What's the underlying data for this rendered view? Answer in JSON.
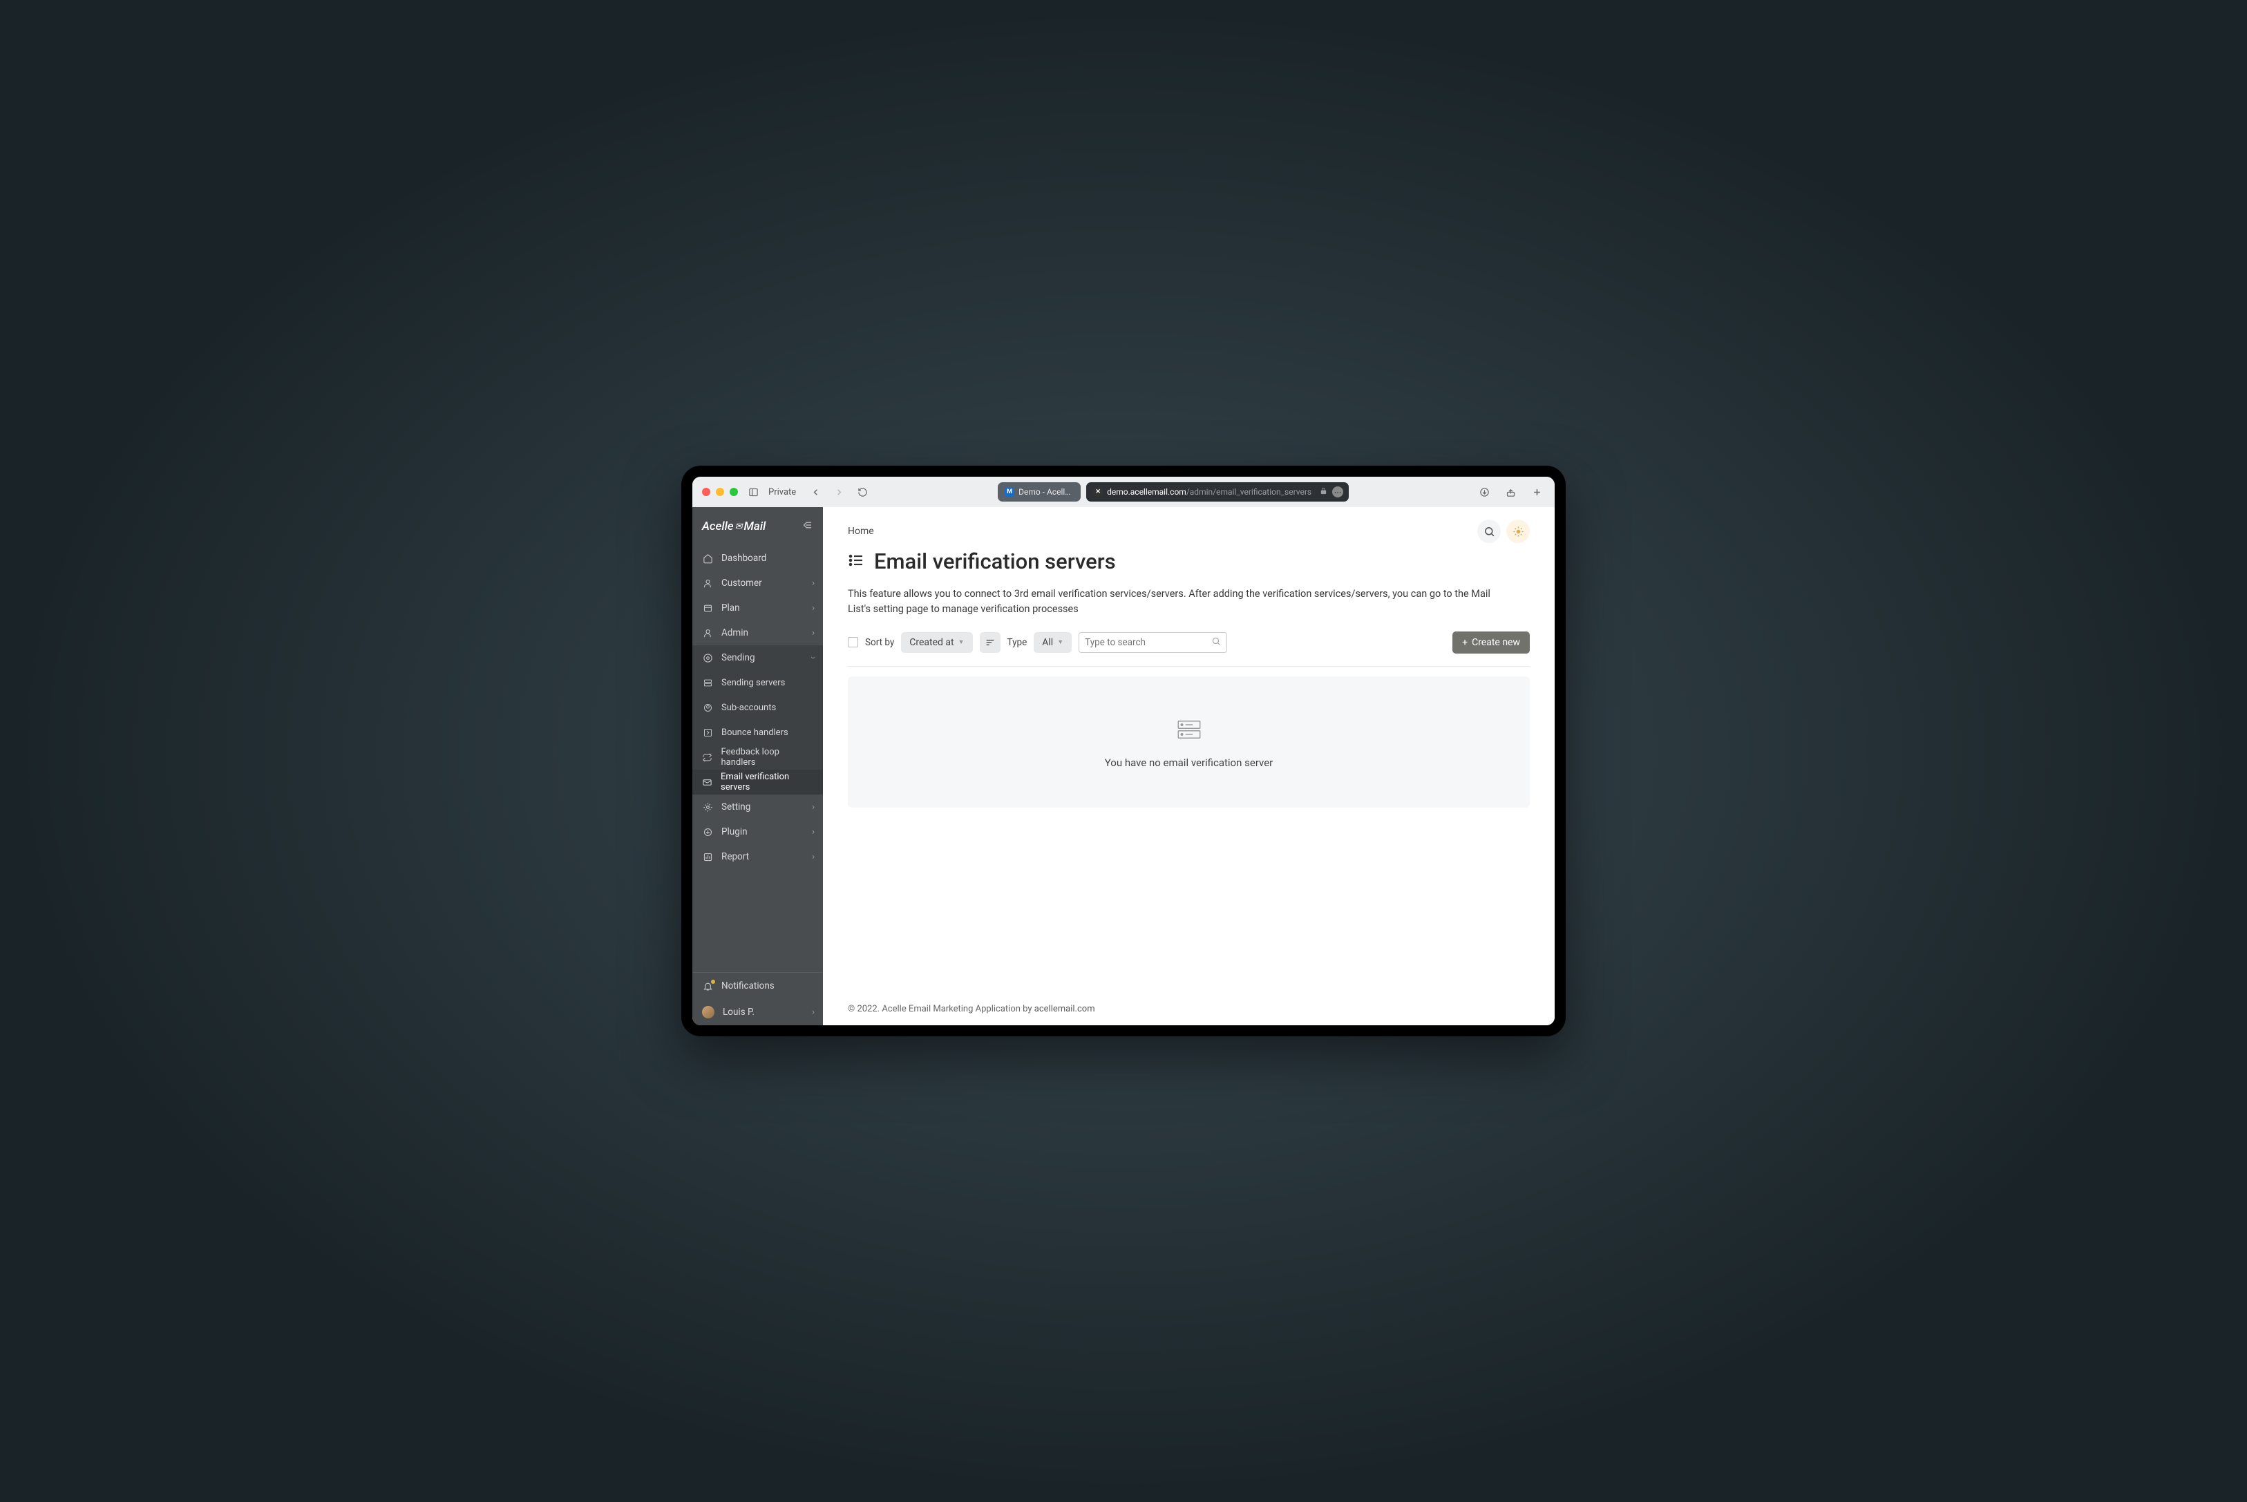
{
  "chrome": {
    "private": "Private",
    "tab1": "Demo - Acelle E...",
    "url_host": "demo.acellemail.com",
    "url_path": "/admin/email_verification_servers"
  },
  "logo": {
    "a": "Acelle",
    "b": "Mail"
  },
  "nav": {
    "dashboard": "Dashboard",
    "customer": "Customer",
    "plan": "Plan",
    "admin": "Admin",
    "sending": "Sending",
    "sending_servers": "Sending servers",
    "sub_accounts": "Sub-accounts",
    "bounce_handlers": "Bounce handlers",
    "feedback_loop": "Feedback loop handlers",
    "email_verification": "Email verification servers",
    "setting": "Setting",
    "plugin": "Plugin",
    "report": "Report",
    "notifications": "Notifications",
    "user": "Louis P."
  },
  "page": {
    "breadcrumb": "Home",
    "title": "Email verification servers",
    "description": "This feature allows you to connect to 3rd email verification services/servers. After adding the verification services/servers, you can go to the Mail List's setting page to manage verification processes",
    "sort_label": "Sort by",
    "sort_value": "Created at",
    "type_label": "Type",
    "type_value": "All",
    "search_placeholder": "Type to search",
    "create_btn": "Create new",
    "empty_msg": "You have no email verification server"
  },
  "footer": {
    "text": "© 2022. Acelle Email Marketing Application by ",
    "link": "acellemail.com"
  }
}
